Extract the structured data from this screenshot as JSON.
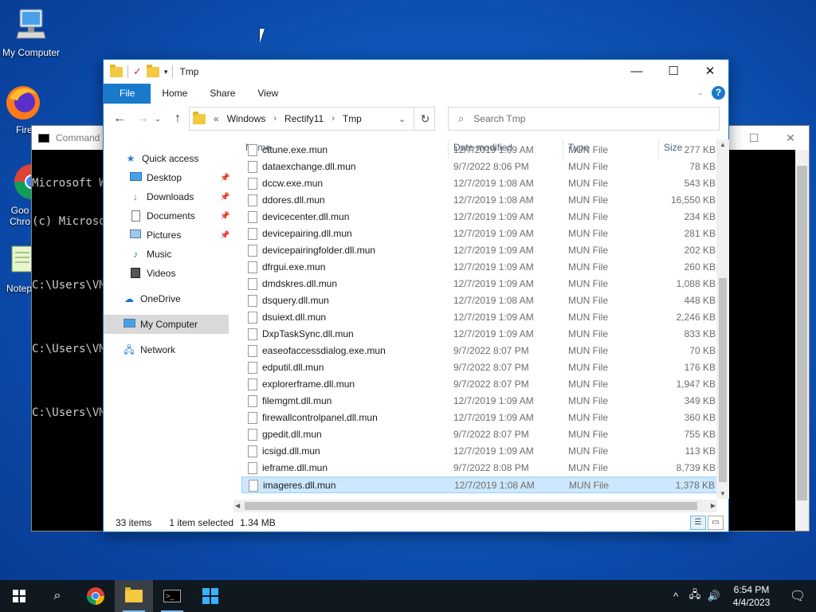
{
  "desktop": {
    "icons": [
      {
        "label": "My Computer",
        "icon": "computer-icon"
      },
      {
        "label": "Fire",
        "icon": "firefox-icon"
      },
      {
        "label": "Goo Chro",
        "icon": "chrome-icon"
      },
      {
        "label": "Notep",
        "icon": "notepad-icon"
      }
    ]
  },
  "cmd": {
    "title": "Command",
    "lines": [
      "Microsoft W",
      "(c) Microso",
      "",
      "C:\\Users\\VM",
      "",
      "C:\\Users\\VM",
      "",
      "C:\\Users\\VM"
    ]
  },
  "explorer": {
    "title": "Tmp",
    "ribbon_tabs": [
      "File",
      "Home",
      "Share",
      "View"
    ],
    "address": {
      "prefix": "«",
      "crumbs": [
        "Windows",
        "Rectify11",
        "Tmp"
      ]
    },
    "search_placeholder": "Search Tmp",
    "nav": {
      "quick_access": "Quick access",
      "desktop": "Desktop",
      "downloads": "Downloads",
      "documents": "Documents",
      "pictures": "Pictures",
      "music": "Music",
      "videos": "Videos",
      "onedrive": "OneDrive",
      "my_computer": "My Computer",
      "network": "Network"
    },
    "columns": {
      "name": "Name",
      "date": "Date modified",
      "type": "Type",
      "size": "Size"
    },
    "files": [
      {
        "name": "cttune.exe.mun",
        "date": "12/7/2019 1:09 AM",
        "type": "MUN File",
        "size": "277 KB"
      },
      {
        "name": "dataexchange.dll.mun",
        "date": "9/7/2022 8:06 PM",
        "type": "MUN File",
        "size": "78 KB"
      },
      {
        "name": "dccw.exe.mun",
        "date": "12/7/2019 1:08 AM",
        "type": "MUN File",
        "size": "543 KB"
      },
      {
        "name": "ddores.dll.mun",
        "date": "12/7/2019 1:08 AM",
        "type": "MUN File",
        "size": "16,550 KB"
      },
      {
        "name": "devicecenter.dll.mun",
        "date": "12/7/2019 1:09 AM",
        "type": "MUN File",
        "size": "234 KB"
      },
      {
        "name": "devicepairing.dll.mun",
        "date": "12/7/2019 1:09 AM",
        "type": "MUN File",
        "size": "281 KB"
      },
      {
        "name": "devicepairingfolder.dll.mun",
        "date": "12/7/2019 1:09 AM",
        "type": "MUN File",
        "size": "202 KB"
      },
      {
        "name": "dfrgui.exe.mun",
        "date": "12/7/2019 1:09 AM",
        "type": "MUN File",
        "size": "260 KB"
      },
      {
        "name": "dmdskres.dll.mun",
        "date": "12/7/2019 1:09 AM",
        "type": "MUN File",
        "size": "1,088 KB"
      },
      {
        "name": "dsquery.dll.mun",
        "date": "12/7/2019 1:08 AM",
        "type": "MUN File",
        "size": "448 KB"
      },
      {
        "name": "dsuiext.dll.mun",
        "date": "12/7/2019 1:09 AM",
        "type": "MUN File",
        "size": "2,246 KB"
      },
      {
        "name": "DxpTaskSync.dll.mun",
        "date": "12/7/2019 1:09 AM",
        "type": "MUN File",
        "size": "833 KB"
      },
      {
        "name": "easeofaccessdialog.exe.mun",
        "date": "9/7/2022 8:07 PM",
        "type": "MUN File",
        "size": "70 KB"
      },
      {
        "name": "edputil.dll.mun",
        "date": "9/7/2022 8:07 PM",
        "type": "MUN File",
        "size": "176 KB"
      },
      {
        "name": "explorerframe.dll.mun",
        "date": "9/7/2022 8:07 PM",
        "type": "MUN File",
        "size": "1,947 KB"
      },
      {
        "name": "filemgmt.dll.mun",
        "date": "12/7/2019 1:09 AM",
        "type": "MUN File",
        "size": "349 KB"
      },
      {
        "name": "firewallcontrolpanel.dll.mun",
        "date": "12/7/2019 1:09 AM",
        "type": "MUN File",
        "size": "360 KB"
      },
      {
        "name": "gpedit.dll.mun",
        "date": "9/7/2022 8:07 PM",
        "type": "MUN File",
        "size": "755 KB"
      },
      {
        "name": "icsigd.dll.mun",
        "date": "12/7/2019 1:09 AM",
        "type": "MUN File",
        "size": "113 KB"
      },
      {
        "name": "ieframe.dll.mun",
        "date": "9/7/2022 8:08 PM",
        "type": "MUN File",
        "size": "8,739 KB"
      },
      {
        "name": "imageres.dll.mun",
        "date": "12/7/2019 1:08 AM",
        "type": "MUN File",
        "size": "1,378 KB",
        "selected": true
      }
    ],
    "status": {
      "count": "33 items",
      "selected": "1 item selected",
      "size": "1.34 MB"
    }
  },
  "taskbar": {
    "time": "6:54 PM",
    "date": "4/4/2023"
  }
}
